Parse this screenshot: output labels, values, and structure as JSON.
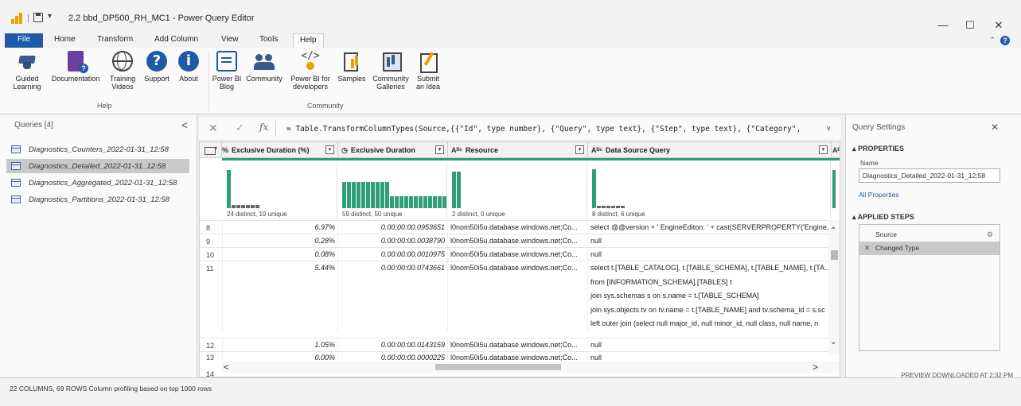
{
  "titlebar": {
    "title": "2.2 bbd_DP500_RH_MC1 - Power Query Editor",
    "quick_access": "▾",
    "minimize": "—",
    "maximize": "☐",
    "close": "✕"
  },
  "ribbon": {
    "tabs": [
      "File",
      "Home",
      "Transform",
      "Add Column",
      "View",
      "Tools",
      "Help"
    ],
    "active_tab": "Help",
    "help_groups": [
      {
        "label": "Help",
        "buttons": [
          {
            "label": "Guided Learning",
            "icon": "graduation-cap-icon"
          },
          {
            "label": "Documentation",
            "icon": "documentation-icon"
          },
          {
            "label": "Training Videos",
            "icon": "globe-icon"
          },
          {
            "label": "Support",
            "icon": "question-icon"
          },
          {
            "label": "About",
            "icon": "info-icon"
          }
        ]
      },
      {
        "label": "Community",
        "buttons": [
          {
            "label": "Power BI Blog",
            "icon": "blog-icon"
          },
          {
            "label": "Community",
            "icon": "people-icon"
          },
          {
            "label": "Power BI for developers",
            "icon": "code-icon"
          },
          {
            "label": "Samples",
            "icon": "samples-icon"
          },
          {
            "label": "Community Galleries",
            "icon": "gallery-icon"
          },
          {
            "label": "Submit an Idea",
            "icon": "idea-icon"
          }
        ]
      }
    ],
    "support_glyph": "?",
    "about_glyph": "i",
    "code_glyph": "</>"
  },
  "queries": {
    "header": "Queries [4]",
    "collapse_glyph": "<",
    "items": [
      "Diagnostics_Counters_2022-01-31_12:58",
      "Diagnostics_Detailed_2022-01-31_12:58",
      "Diagnostics_Aggregated_2022-01-31_12:58",
      "Diagnostics_Partitions_2022-01-31_12:58"
    ],
    "selected_index": 1
  },
  "formula_bar": {
    "cancel_glyph": "✕",
    "commit_glyph": "✓",
    "fx_glyph": "fx",
    "formula": "= Table.TransformColumnTypes(Source,{{\"Id\", type number}, {\"Query\", type text}, {\"Step\", type text}, {\"Category\",",
    "expand_glyph": "∨"
  },
  "grid": {
    "columns": [
      {
        "type_icon": "%",
        "name": "Exclusive Duration (%)"
      },
      {
        "type_icon": "◷",
        "name": "Exclusive Duration"
      },
      {
        "type_icon": "Aᴮᶜ",
        "name": "Resource"
      },
      {
        "type_icon": "Aᴮᶜ",
        "name": "Data Source Query"
      }
    ],
    "profile": [
      {
        "summary": "24 distinct, 19 unique"
      },
      {
        "summary": "59 distinct, 50 unique"
      },
      {
        "summary": "2 distinct, 0 unique"
      },
      {
        "summary": "8 distinct, 6 unique"
      }
    ],
    "rows": [
      {
        "num": "8",
        "pct": "6.97%",
        "dur": "0.00:00:00.0953651",
        "res": "l0nom50i5u.database.windows.net;Co...",
        "query": [
          "select @@version + ' EngineEditon: ' + cast(SERVERPROPERTY('Engine..."
        ]
      },
      {
        "num": "9",
        "pct": "0.28%",
        "dur": "0.00:00:00.0038790",
        "res": "l0nom50i5u.database.windows.net;Co...",
        "query": [
          "null"
        ]
      },
      {
        "num": "10",
        "pct": "0.08%",
        "dur": "0.00:00:00.0010975",
        "res": "l0nom50i5u.database.windows.net;Co...",
        "query": [
          "null"
        ]
      },
      {
        "num": "11",
        "pct": "5.44%",
        "dur": "0.00:00:00.0743661",
        "res": "l0nom50i5u.database.windows.net;Co...",
        "query": [
          "select t.[TABLE_CATALOG], t.[TABLE_SCHEMA], t.[TABLE_NAME], t.[TA...",
          "from [INFORMATION_SCHEMA].[TABLES] t",
          "join sys.schemas s on s.name = t.[TABLE_SCHEMA]",
          "join sys.objects tv on tv.name = t.[TABLE_NAME] and tv.schema_id = s.sc",
          "left outer join (select null major_id, null minor_id, null class, null name, n"
        ]
      },
      {
        "num": "12",
        "pct": "1.05%",
        "dur": "0.00:00:00.0143159",
        "res": "l0nom50i5u.database.windows.net;Co...",
        "query": [
          "null"
        ]
      },
      {
        "num": "13",
        "pct": "0.00%",
        "dur": "0.00:00:00.0000225",
        "res": "l0nom50i5u.database.windows.net;Co...",
        "query": [
          "null"
        ]
      },
      {
        "num": "14",
        "pct": "",
        "dur": "",
        "res": "",
        "query": [
          ""
        ]
      }
    ],
    "scroll_up": "⌃",
    "scroll_down": "⌄",
    "scroll_left": "<",
    "scroll_right": ">"
  },
  "query_settings": {
    "title": "Query Settings",
    "close_glyph": "✕",
    "properties_label": "▴ PROPERTIES",
    "name_label": "Name",
    "name_value": "Diagnostics_Detailed_2022-01-31_12:58",
    "all_properties": "All Properties",
    "applied_steps_label": "▴ APPLIED STEPS",
    "steps": [
      {
        "name": "Source"
      },
      {
        "name": "Changed Type"
      }
    ],
    "selected_step": 1,
    "gear_glyph": "⚙",
    "delete_glyph": "✕"
  },
  "status_bar": {
    "left": "22 COLUMNS, 69 ROWS    Column profiling based on top 1000 rows",
    "right": "PREVIEW DOWNLOADED AT 2:32 PM"
  },
  "colors": {
    "file_tab": "#1e5aa8",
    "profile_bar": "#2f9e7a",
    "selection": "#c9c9c9",
    "accent_yellow": "#e8a200"
  },
  "profile_bars": [
    [
      0.88,
      0.07,
      0.07,
      0.07,
      0.07,
      0.07,
      0.07
    ],
    [
      0.62,
      0.62,
      0.62,
      0.62,
      0.62,
      0.62,
      0.62,
      0.62,
      0.62,
      0.62,
      0.27,
      0.27,
      0.27,
      0.27,
      0.27,
      0.27,
      0.27,
      0.27,
      0.27,
      0.27,
      0.27,
      0.27
    ],
    [
      0.85,
      0.85
    ],
    [
      0.9,
      0.05,
      0.05,
      0.05,
      0.05,
      0.05,
      0.05
    ]
  ]
}
